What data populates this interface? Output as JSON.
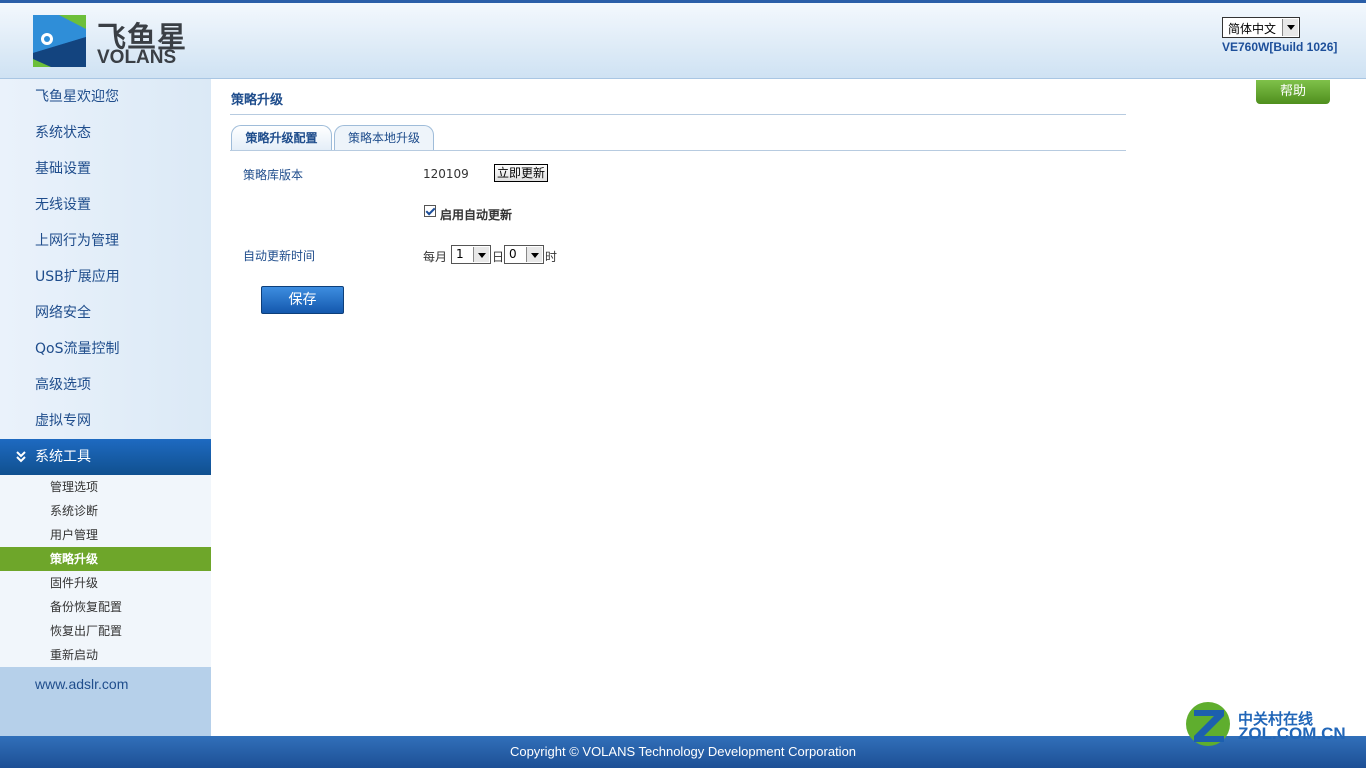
{
  "header": {
    "logo_cn": "飞鱼星",
    "logo_en": "VOLANS",
    "language": "简体中文",
    "build": "VE760W[Build 1026]"
  },
  "sidebar": {
    "items": [
      {
        "label": "飞鱼星欢迎您"
      },
      {
        "label": "系统状态"
      },
      {
        "label": "基础设置"
      },
      {
        "label": "无线设置"
      },
      {
        "label": "上网行为管理"
      },
      {
        "label": "USB扩展应用"
      },
      {
        "label": "网络安全"
      },
      {
        "label": "QoS流量控制"
      },
      {
        "label": "高级选项"
      },
      {
        "label": "虚拟专网"
      },
      {
        "label": "系统工具"
      }
    ],
    "active_chevron": "»",
    "sub_items": [
      {
        "label": "管理选项"
      },
      {
        "label": "系统诊断"
      },
      {
        "label": "用户管理"
      },
      {
        "label": "策略升级"
      },
      {
        "label": "固件升级"
      },
      {
        "label": "备份恢复配置"
      },
      {
        "label": "恢复出厂配置"
      },
      {
        "label": "重新启动"
      }
    ],
    "site_link": "www.adslr.com"
  },
  "main": {
    "title": "策略升级",
    "tabs": [
      {
        "label": "策略升级配置"
      },
      {
        "label": "策略本地升级"
      }
    ],
    "form": {
      "version_label": "策略库版本",
      "version_value": "120109",
      "update_now": "立即更新",
      "auto_update_label": "启用自动更新",
      "auto_update_checked": true,
      "time_label": "自动更新时间",
      "monthly": "每月",
      "day_value": "1",
      "day_unit": "日",
      "hour_value": "0",
      "hour_unit": "时",
      "save": "保存"
    },
    "help": "帮助"
  },
  "footer": {
    "copyright": "Copyright © VOLANS Technology Development Corporation"
  },
  "watermark": {
    "cn": "中关村在线",
    "en": "ZOL.COM.CN"
  },
  "colors": {
    "brand_blue": "#1f4d8c",
    "active_green": "#6ea62a",
    "footer_blue": "#1d4f95"
  }
}
